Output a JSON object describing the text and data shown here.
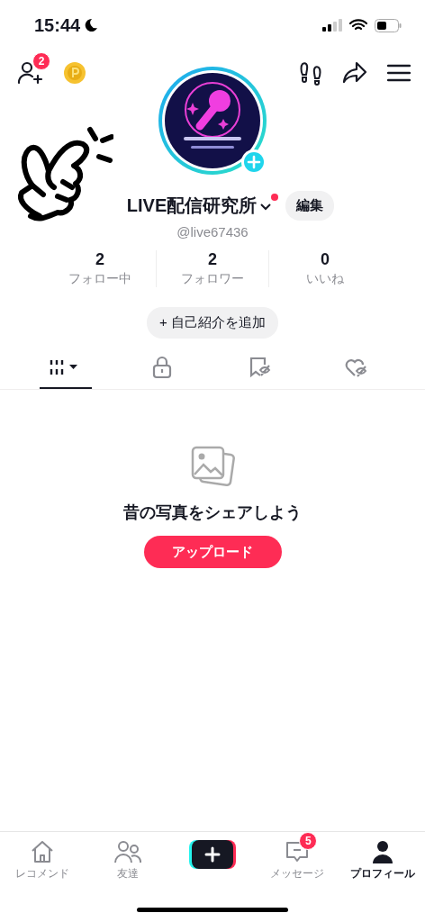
{
  "status_bar": {
    "time": "15:44"
  },
  "top_bar": {
    "friend_badge": "2"
  },
  "profile": {
    "name": "LIVE配信研究所",
    "notification_dot": true,
    "edit_button": "編集",
    "handle": "@live67436",
    "stats": [
      {
        "value": "2",
        "label": "フォロー中"
      },
      {
        "value": "2",
        "label": "フォロワー"
      },
      {
        "value": "0",
        "label": "いいね"
      }
    ],
    "bio_button": "+ 自己紹介を追加"
  },
  "tabs": [
    {
      "kind": "grid",
      "selected": true
    },
    {
      "kind": "lock",
      "selected": false
    },
    {
      "kind": "bookmark",
      "selected": false
    },
    {
      "kind": "liked",
      "selected": false
    }
  ],
  "empty_state": {
    "message": "昔の写真をシェアしよう",
    "button": "アップロード"
  },
  "nav": [
    {
      "kind": "home",
      "label": "レコメンド",
      "selected": false
    },
    {
      "kind": "friends",
      "label": "友達",
      "selected": false
    },
    {
      "kind": "create"
    },
    {
      "kind": "inbox",
      "label": "メッセージ",
      "badge": "5",
      "selected": false
    },
    {
      "kind": "profile",
      "label": "プロフィール",
      "selected": true
    }
  ],
  "overlay": {
    "kind": "snap-hand"
  }
}
